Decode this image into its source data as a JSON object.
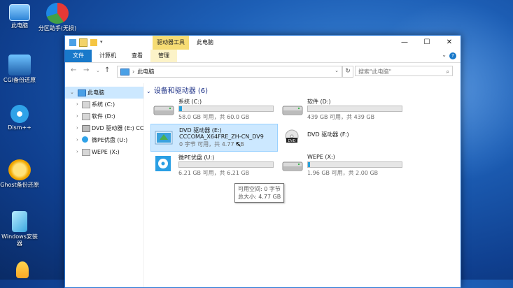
{
  "desktop": {
    "icons": [
      {
        "label": "此电脑",
        "icon": "computer-icon"
      },
      {
        "label": "分区助手(无损)",
        "icon": "partition-assistant-icon"
      },
      {
        "label": "CGI备份还原",
        "icon": "cgi-backup-icon"
      },
      {
        "label": "Dism++",
        "icon": "dism-gear-icon"
      },
      {
        "label": "Ghost备份还原",
        "icon": "ghost-icon"
      },
      {
        "label": "Windows安装器",
        "icon": "windows-installer-icon"
      }
    ]
  },
  "window": {
    "context_tab": "驱动器工具",
    "title": "此电脑",
    "controls": {
      "minimize": "—",
      "maximize": "☐",
      "close": "✕"
    },
    "ribbon_tabs": [
      "文件",
      "计算机",
      "查看",
      "管理"
    ],
    "help": "?"
  },
  "address": {
    "path": "此电脑",
    "search_placeholder": "搜索\"此电脑\""
  },
  "sidebar": {
    "items": [
      {
        "label": "此电脑",
        "icon": "computer-icon",
        "selected": true
      },
      {
        "label": "系统 (C:)",
        "icon": "hard-drive-icon"
      },
      {
        "label": "软件 (D:)",
        "icon": "hard-drive-icon"
      },
      {
        "label": "DVD 驱动器 (E:) CC",
        "icon": "dvd-drive-icon"
      },
      {
        "label": "微PE优盘 (U:)",
        "icon": "usb-drive-icon"
      },
      {
        "label": "WEPE (X:)",
        "icon": "hard-drive-icon"
      }
    ]
  },
  "main": {
    "group_title": "设备和驱动器 (6)",
    "drives": [
      {
        "name": "系统 (C:)",
        "size": "58.0 GB 可用，共 60.0 GB",
        "used_fraction": 0.03,
        "icon": "hard-drive-icon"
      },
      {
        "name": "软件 (D:)",
        "size": "439 GB 可用，共 439 GB",
        "used_fraction": 0.0,
        "icon": "hard-drive-icon"
      },
      {
        "name": "DVD 驱动器 (E:)",
        "name2": "CCCOMA_X64FRE_ZH-CN_DV9",
        "size": "0 字节 可用，共 4.77 GB",
        "icon": "dvd-disc-icon",
        "selected": true
      },
      {
        "name": "DVD 驱动器 (F:)",
        "icon": "dvd-drive-icon"
      },
      {
        "name": "微PE优盘 (U:)",
        "size": "6.21 GB 可用，共 6.21 GB",
        "used_fraction": 0.0,
        "icon": "usb-drive-icon"
      },
      {
        "name": "WEPE (X:)",
        "size": "1.96 GB 可用，共 2.00 GB",
        "used_fraction": 0.02,
        "icon": "hard-drive-icon"
      }
    ],
    "tooltip": {
      "line1": "可用空间: 0 字节",
      "line2": "总大小: 4.77 GB"
    }
  },
  "colors": {
    "accent": "#1979ca",
    "bar_fill": "#26a0da",
    "selection": "#cce8ff",
    "context_tab": "#f6dc74"
  }
}
